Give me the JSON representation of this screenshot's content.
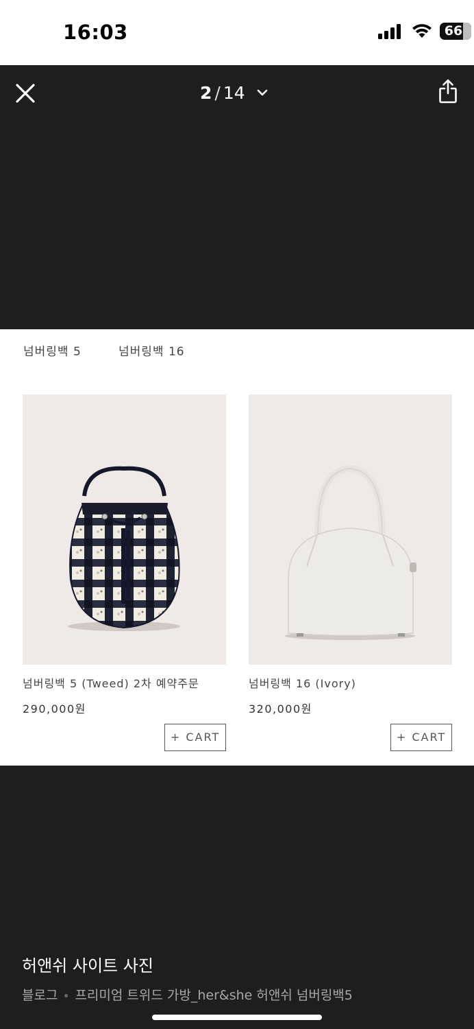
{
  "status_bar": {
    "time": "16:03",
    "battery": "66"
  },
  "viewer": {
    "current_page": "2",
    "separator": "/",
    "total_pages": "14"
  },
  "tabs": [
    {
      "label": "넘버링백 5"
    },
    {
      "label": "넘버링백 16"
    }
  ],
  "products": [
    {
      "name": "넘버링백 5 (Tweed) 2차 예약주문",
      "price": "290,000원",
      "cart_label": "+ CART",
      "image": "tweed-bucket-bag"
    },
    {
      "name": "넘버링백 16 (Ivory)",
      "price": "320,000원",
      "cart_label": "+ CART",
      "image": "ivory-dome-bag"
    }
  ],
  "caption": {
    "title": "허앤쉬 사이트 사진",
    "source": "블로그",
    "description": "프리미엄 트위드 가방_her&she 허앤쉬 넘버링백5"
  },
  "colors": {
    "viewer_bg": "#1e1e1f",
    "product_bg": "#efe9e7"
  }
}
